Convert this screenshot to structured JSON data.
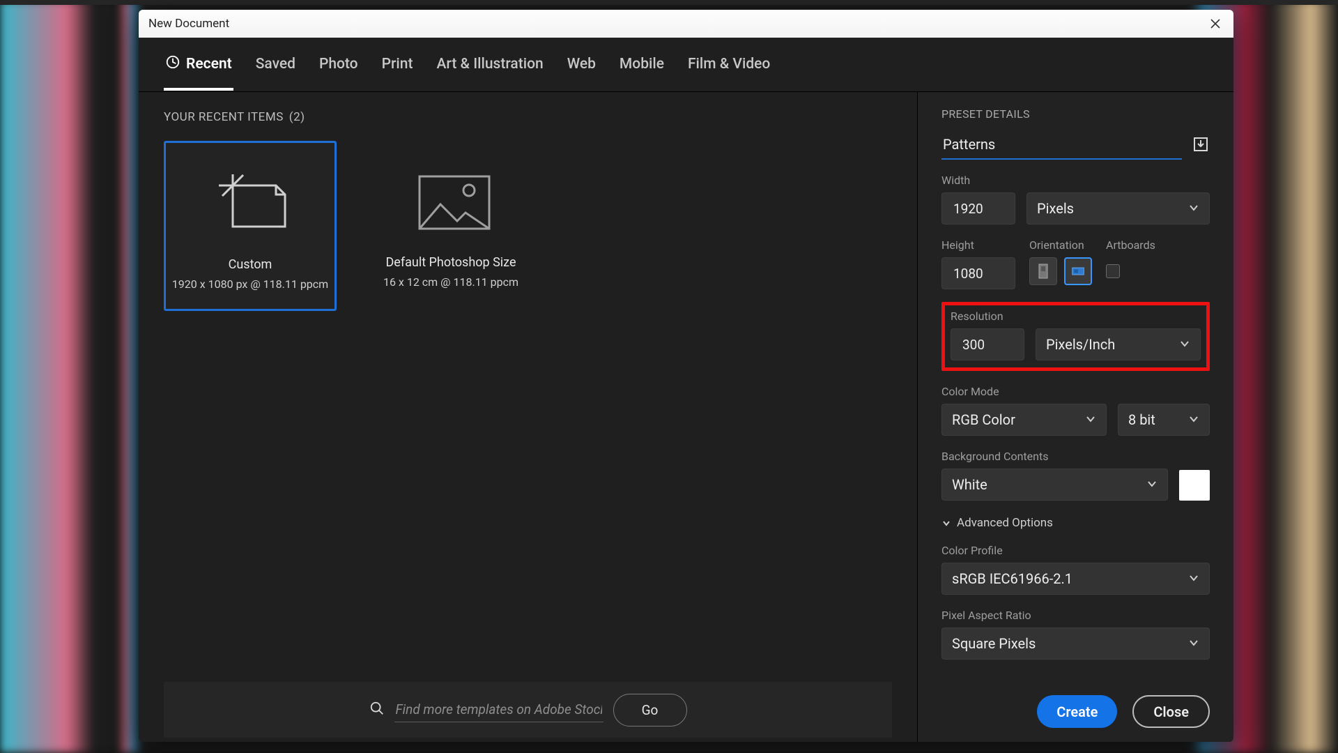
{
  "window": {
    "title": "New Document"
  },
  "tabs": [
    "Recent",
    "Saved",
    "Photo",
    "Print",
    "Art & Illustration",
    "Web",
    "Mobile",
    "Film & Video"
  ],
  "recent": {
    "header": "YOUR RECENT ITEMS",
    "count": "(2)",
    "items": [
      {
        "title": "Custom",
        "meta": "1920 x 1080 px @ 118.11 ppcm"
      },
      {
        "title": "Default Photoshop Size",
        "meta": "16 x 12 cm @ 118.11 ppcm"
      }
    ]
  },
  "search": {
    "placeholder": "Find more templates on Adobe Stock",
    "go": "Go"
  },
  "details": {
    "section": "PRESET DETAILS",
    "name": "Patterns",
    "width_label": "Width",
    "width": "1920",
    "unit": "Pixels",
    "height_label": "Height",
    "height": "1080",
    "orientation_label": "Orientation",
    "artboards_label": "Artboards",
    "resolution_label": "Resolution",
    "resolution": "300",
    "res_unit": "Pixels/Inch",
    "colormode_label": "Color Mode",
    "colormode": "RGB Color",
    "bitdepth": "8 bit",
    "bg_label": "Background Contents",
    "bg": "White",
    "adv": "Advanced Options",
    "profile_label": "Color Profile",
    "profile": "sRGB IEC61966-2.1",
    "par_label": "Pixel Aspect Ratio",
    "par": "Square Pixels"
  },
  "buttons": {
    "create": "Create",
    "close": "Close"
  },
  "icons": {
    "chevron": "chevron-down-icon",
    "search": "search-icon",
    "download": "save-preset-icon",
    "close": "close-icon",
    "recent": "clock-icon"
  }
}
